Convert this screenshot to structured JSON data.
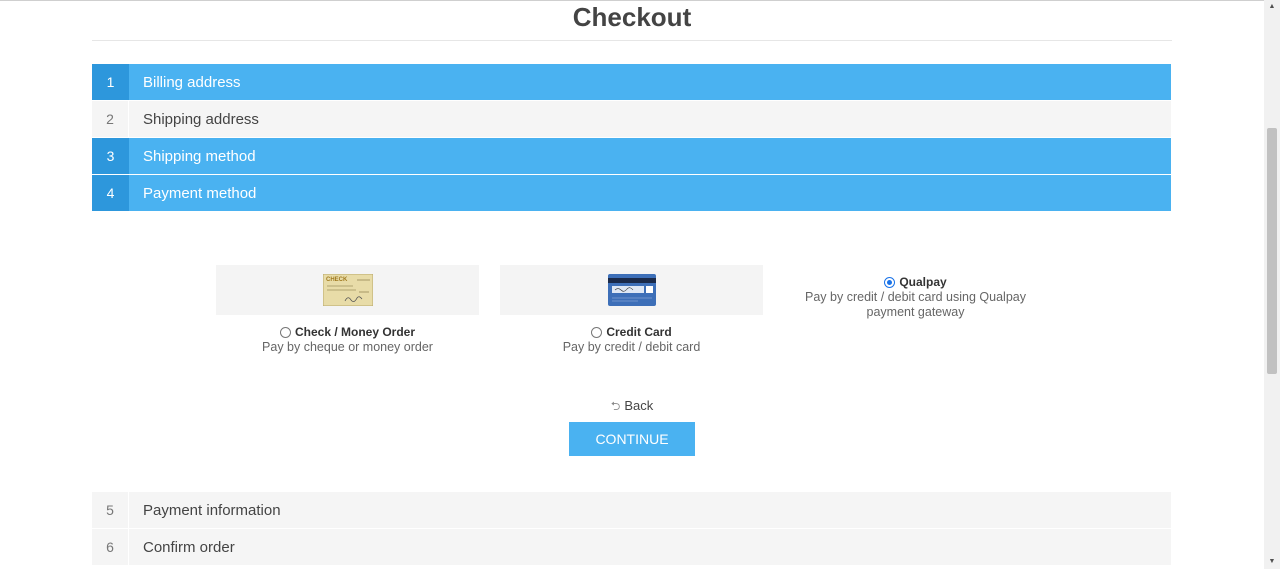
{
  "page": {
    "title": "Checkout"
  },
  "steps": [
    {
      "number": "1",
      "label": "Billing address",
      "state": "active"
    },
    {
      "number": "2",
      "label": "Shipping address",
      "state": "inactive"
    },
    {
      "number": "3",
      "label": "Shipping method",
      "state": "active"
    },
    {
      "number": "4",
      "label": "Payment method",
      "state": "active"
    },
    {
      "number": "5",
      "label": "Payment information",
      "state": "inactive"
    },
    {
      "number": "6",
      "label": "Confirm order",
      "state": "inactive"
    }
  ],
  "payment_methods": [
    {
      "name": "Check / Money Order",
      "description": "Pay by cheque or money order",
      "selected": false,
      "icon": "check-image-icon",
      "image_text": "CHECK"
    },
    {
      "name": "Credit Card",
      "description": "Pay by credit / debit card",
      "selected": false,
      "icon": "credit-card-image-icon"
    },
    {
      "name": "Qualpay",
      "description_line1": "Pay by credit / debit card using Qualpay",
      "description_line2": "payment gateway",
      "selected": true
    }
  ],
  "actions": {
    "back_label": "Back",
    "back_icon": "undo-arrow-icon",
    "continue_label": "CONTINUE"
  },
  "colors": {
    "accent": "#4ab2f1",
    "accent_dark": "#2d97dc",
    "inactive_bg": "#f5f5f5"
  }
}
